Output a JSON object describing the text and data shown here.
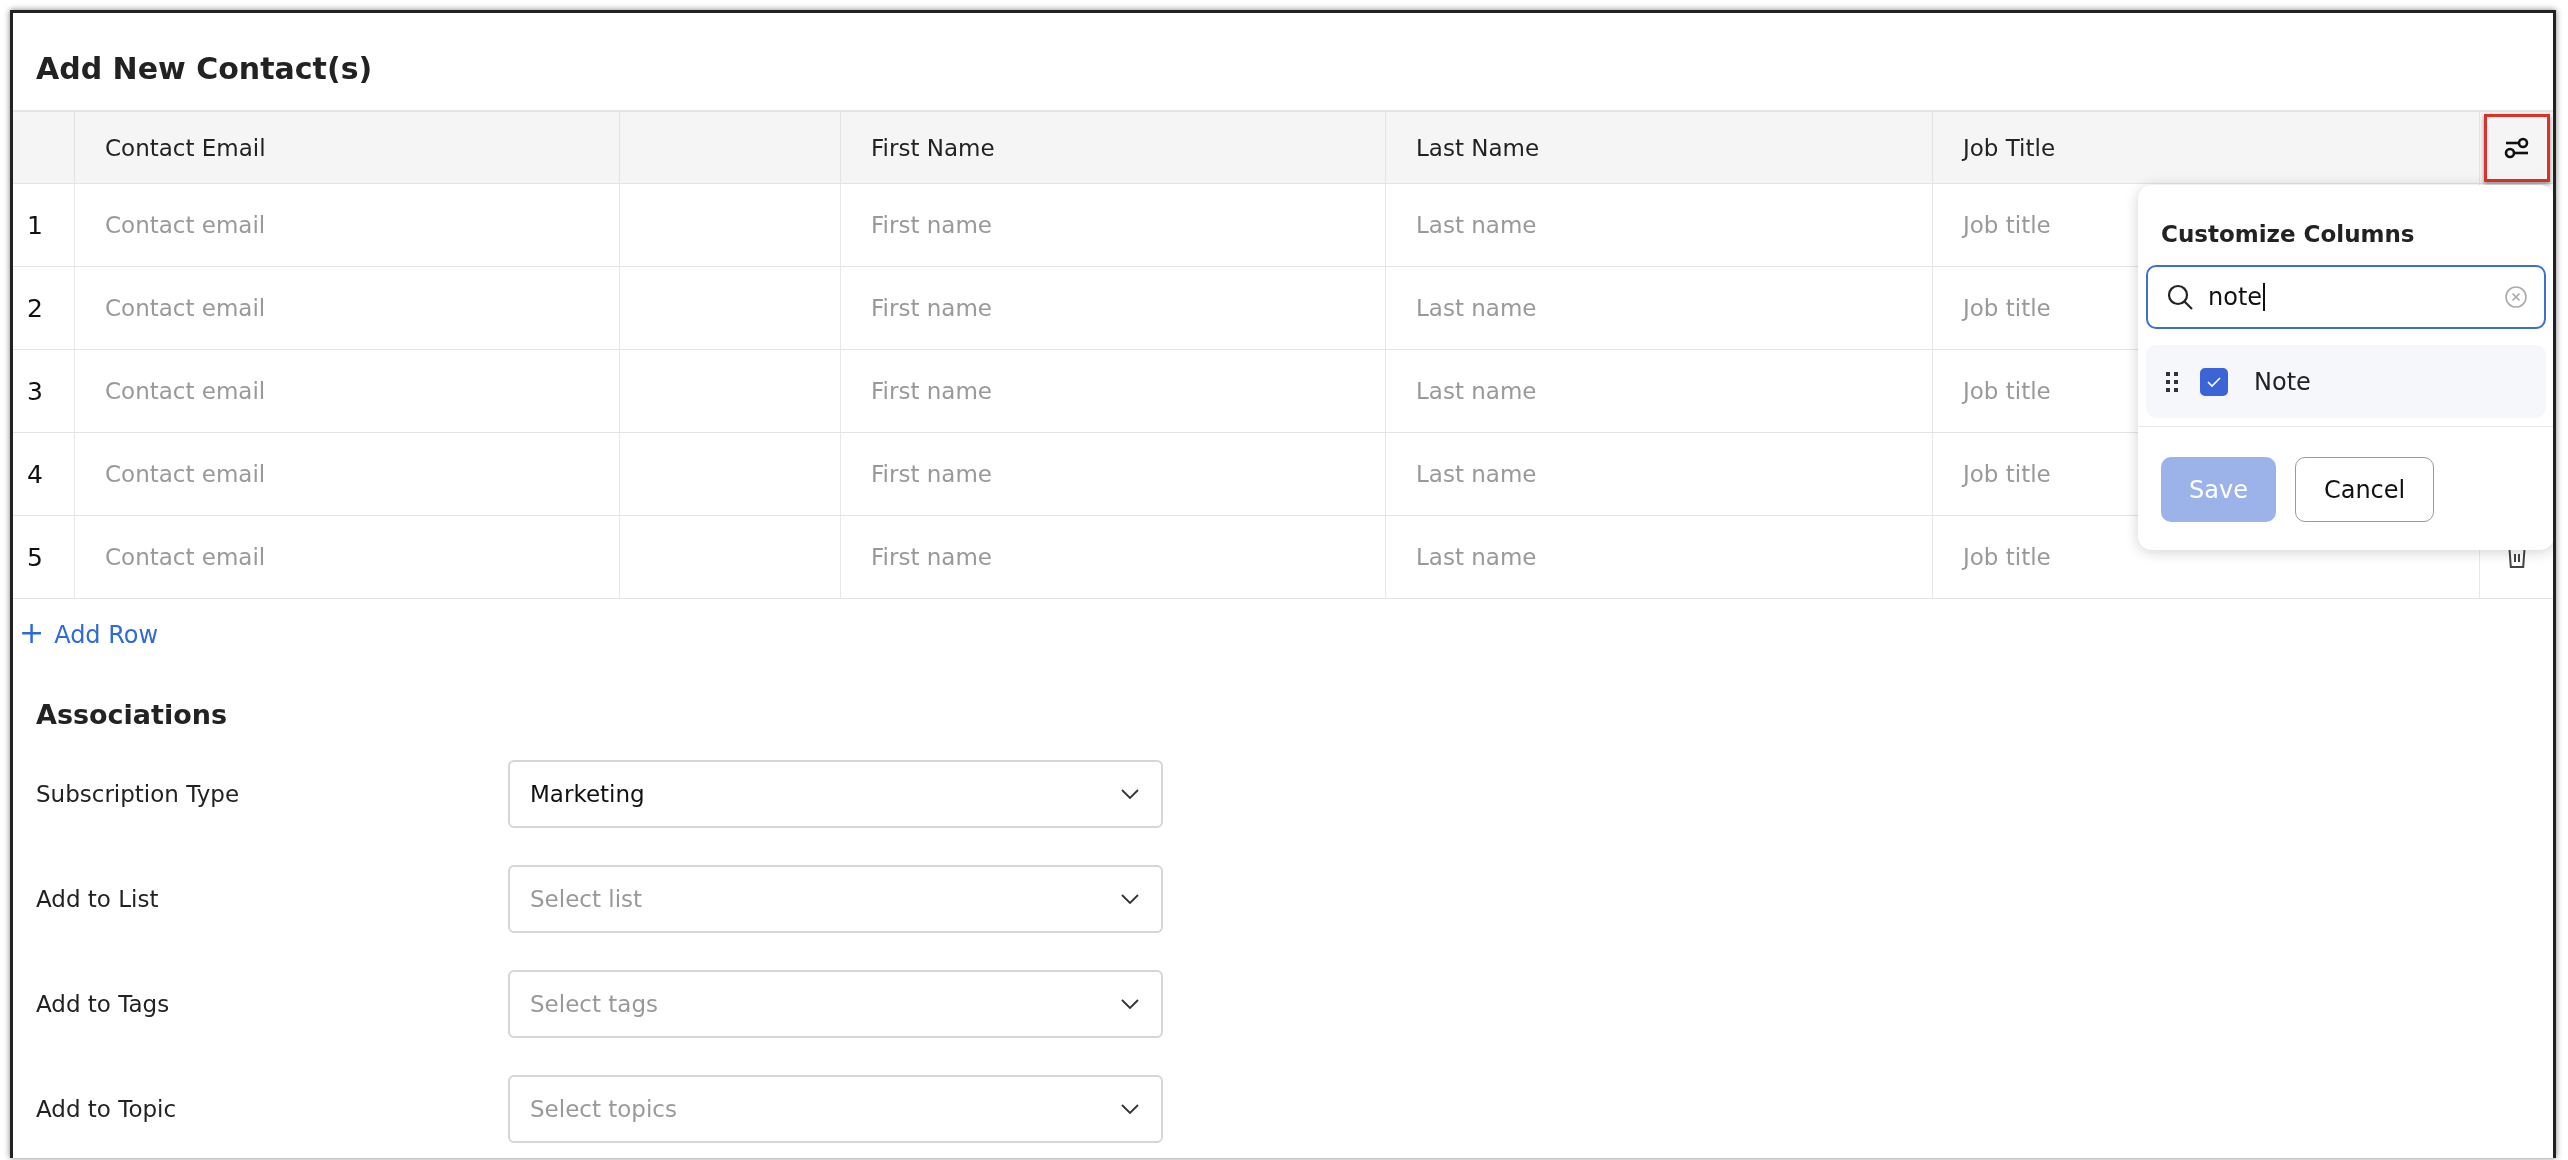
{
  "dialog": {
    "title": "Add New Contact(s)"
  },
  "table": {
    "columns": [
      {
        "kind": "text",
        "label": "Contact Email"
      },
      {
        "kind": "blank"
      },
      {
        "kind": "text",
        "label": "First Name"
      },
      {
        "kind": "text",
        "label": "Last Name"
      },
      {
        "kind": "text",
        "label": "Job Title"
      }
    ],
    "settings_button": {
      "highlighted": true
    },
    "rows": [
      {
        "number": "1",
        "cells": [
          {
            "kind": "text",
            "placeholder": "Contact email"
          },
          {
            "kind": "blank"
          },
          {
            "kind": "text",
            "placeholder": "First name"
          },
          {
            "kind": "text",
            "placeholder": "Last name"
          },
          {
            "kind": "text",
            "placeholder": "Job title"
          }
        ]
      },
      {
        "number": "2",
        "cells": [
          {
            "kind": "text",
            "placeholder": "Contact email"
          },
          {
            "kind": "blank"
          },
          {
            "kind": "text",
            "placeholder": "First name"
          },
          {
            "kind": "text",
            "placeholder": "Last name"
          },
          {
            "kind": "text",
            "placeholder": "Job title"
          }
        ]
      },
      {
        "number": "3",
        "cells": [
          {
            "kind": "text",
            "placeholder": "Contact email"
          },
          {
            "kind": "blank"
          },
          {
            "kind": "text",
            "placeholder": "First name"
          },
          {
            "kind": "text",
            "placeholder": "Last name"
          },
          {
            "kind": "text",
            "placeholder": "Job title"
          }
        ]
      },
      {
        "number": "4",
        "cells": [
          {
            "kind": "text",
            "placeholder": "Contact email"
          },
          {
            "kind": "blank"
          },
          {
            "kind": "text",
            "placeholder": "First name"
          },
          {
            "kind": "text",
            "placeholder": "Last name"
          },
          {
            "kind": "text",
            "placeholder": "Job title"
          }
        ]
      },
      {
        "number": "5",
        "cells": [
          {
            "kind": "text",
            "placeholder": "Contact email"
          },
          {
            "kind": "blank"
          },
          {
            "kind": "text",
            "placeholder": "First name"
          },
          {
            "kind": "text",
            "placeholder": "Last name"
          },
          {
            "kind": "text",
            "placeholder": "Job title"
          }
        ]
      }
    ],
    "add_row": "+ Add Row"
  },
  "associations": {
    "title": "Associations",
    "fields": [
      {
        "label": "Subscription Type",
        "value": "Marketing"
      },
      {
        "label": "Add to List",
        "placeholder": "Select list"
      },
      {
        "label": "Add to Tags",
        "placeholder": "Select tags"
      },
      {
        "label": "Add to Topic",
        "placeholder": "Select topics"
      }
    ]
  },
  "customize_popup": {
    "title": "Customize Columns",
    "search": {
      "value": "note"
    },
    "items": [
      {
        "label": "Note",
        "checked": true
      }
    ],
    "buttons": [
      {
        "label": "Save",
        "kind": "primary",
        "disabled": true
      },
      {
        "label": "Cancel",
        "kind": "secondary",
        "disabled": false
      }
    ]
  }
}
